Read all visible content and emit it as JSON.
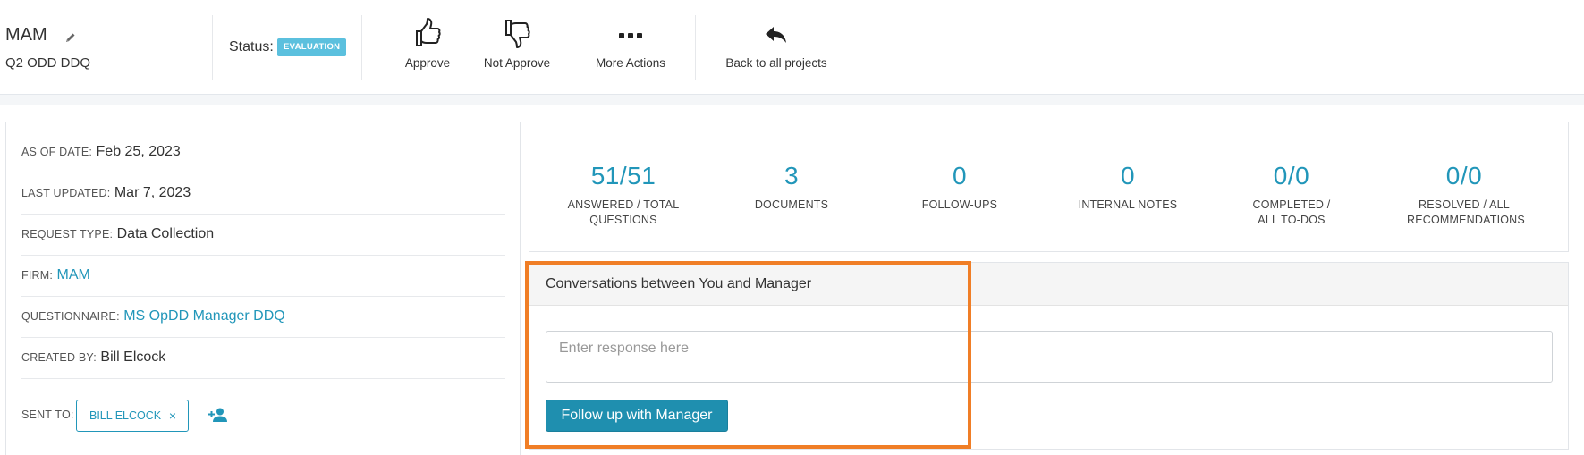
{
  "header": {
    "project_title": "MAM",
    "project_subtitle": "Q2 ODD DDQ",
    "status_label": "Status:",
    "status_badge": "EVALUATION",
    "actions": [
      {
        "label": "Approve",
        "icon": "thumbs-up-icon"
      },
      {
        "label": "Not Approve",
        "icon": "thumbs-down-icon"
      },
      {
        "label": "More Actions",
        "icon": "more-dots-icon"
      },
      {
        "label": "Back to all projects",
        "icon": "reply-arrow-icon"
      }
    ]
  },
  "details": {
    "as_of_date": {
      "label": "AS OF DATE:",
      "value": "Feb 25, 2023"
    },
    "last_updated": {
      "label": "LAST UPDATED:",
      "value": "Mar 7, 2023"
    },
    "request_type": {
      "label": "REQUEST TYPE:",
      "value": "Data Collection"
    },
    "firm": {
      "label": "FIRM:",
      "value": "MAM"
    },
    "questionnaire": {
      "label": "QUESTIONNAIRE:",
      "value": "MS OpDD Manager DDQ"
    },
    "created_by": {
      "label": "CREATED BY:",
      "value": "Bill Elcock"
    },
    "sent_to": {
      "label": "SENT TO:",
      "chip": "BILL ELCOCK",
      "chip_remove": "×"
    }
  },
  "stats": [
    {
      "value": "51/51",
      "caption": "ANSWERED / TOTAL QUESTIONS"
    },
    {
      "value": "3",
      "caption": "DOCUMENTS"
    },
    {
      "value": "0",
      "caption": "FOLLOW-UPS"
    },
    {
      "value": "0",
      "caption": "INTERNAL NOTES"
    },
    {
      "value": "0/0",
      "caption": "COMPLETED / ALL TO-DOS"
    },
    {
      "value": "0/0",
      "caption": "RESOLVED / ALL RECOMMENDATIONS"
    }
  ],
  "conversation": {
    "title": "Conversations between You and Manager",
    "input_placeholder": "Enter response here",
    "input_value": "",
    "button_label": "Follow up with Manager"
  },
  "colors": {
    "accent": "#2196b9",
    "badge": "#5bc0de",
    "button": "#1f8faf",
    "highlight": "#f07e26"
  }
}
